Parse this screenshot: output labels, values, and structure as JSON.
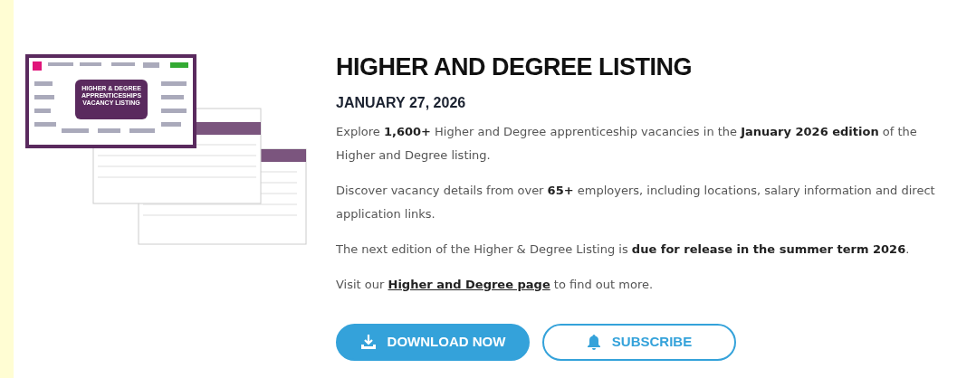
{
  "cover": {
    "title": "HIGHER & DEGREE APPRENTICESHIPS VACANCY LISTING"
  },
  "heading": "HIGHER AND DEGREE LISTING",
  "date": "JANUARY 27, 2026",
  "paragraphs": [
    {
      "kind": "text",
      "text": "Explore **1,600+** Higher and Degree apprenticeship vacancies in the **January 2026 edition** of the Higher and Degree listing."
    },
    {
      "kind": "text",
      "text": "Discover vacancy details from over **65+** employers, including locations, salary information and direct application links."
    },
    {
      "kind": "text",
      "text": "The next edition of the Higher & Degree Listing is **due for release in the summer term 2026**."
    },
    {
      "kind": "link",
      "before": "Visit our",
      "link": "Higher and Degree page",
      "after": "to find out more."
    }
  ],
  "buttons": [
    {
      "label": "DOWNLOAD NOW",
      "kind": "primary"
    },
    {
      "label": "SUBSCRIBE",
      "kind": "outline"
    }
  ]
}
